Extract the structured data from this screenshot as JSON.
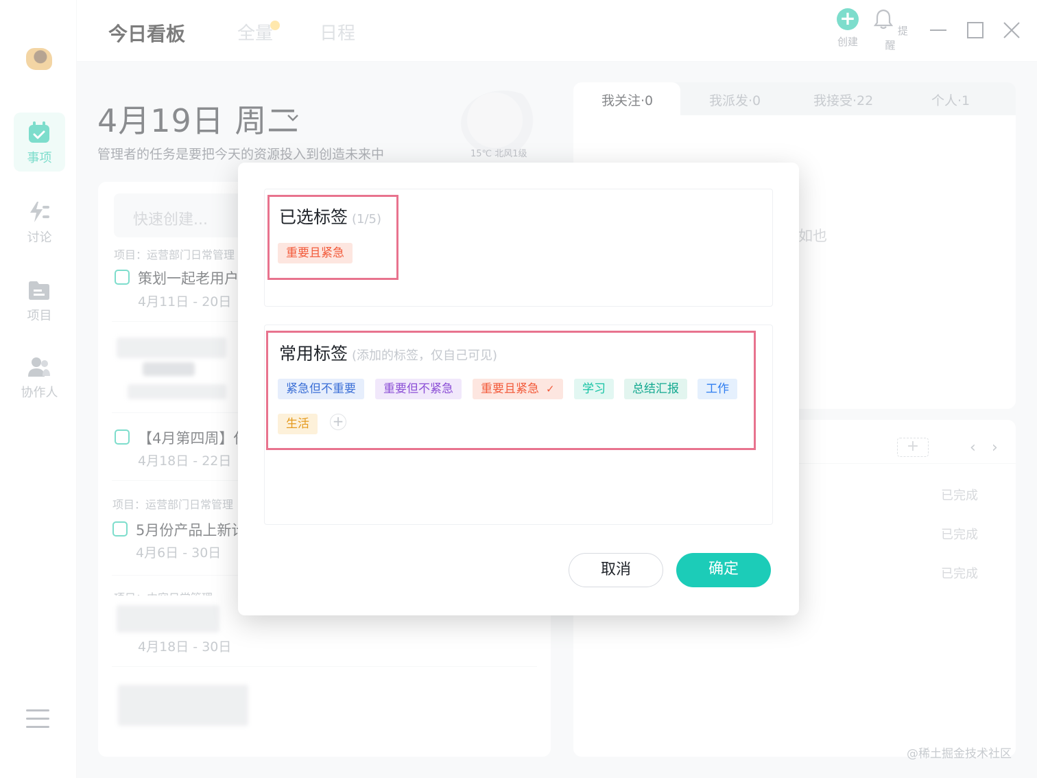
{
  "app": {
    "tabs": [
      {
        "label": "今日看板",
        "active": true
      },
      {
        "label": "全量",
        "active": false
      },
      {
        "label": "日程",
        "active": false
      }
    ],
    "actions": [
      {
        "label": "创建",
        "icon": "plus-circle-icon"
      },
      {
        "label": "提醒",
        "icon": "bell-icon"
      }
    ],
    "accent": "#13c2a3"
  },
  "sidebar": {
    "items": [
      {
        "label": "事项",
        "icon": "calendar-check-icon",
        "active": true
      },
      {
        "label": "讨论",
        "icon": "discussion-icon",
        "active": false
      },
      {
        "label": "项目",
        "icon": "folder-icon",
        "active": false
      },
      {
        "label": "协作人",
        "icon": "people-icon",
        "active": false
      }
    ]
  },
  "header": {
    "date": "4月19日 周二",
    "motto": "管理者的任务是要把今天的资源投入到创造未来中",
    "weather": "15℃ 北风1级"
  },
  "left_panel": {
    "quick_create": "快速创建...",
    "groups": [
      {
        "project": "项目：运营部门日常管理",
        "tasks": [
          {
            "title": "策划一起老用户",
            "date": "4月11日 - 20日"
          }
        ]
      },
      {
        "project": "",
        "tasks": [
          {
            "title": "【4月第四周】任",
            "date": "4月18日 - 22日"
          }
        ]
      },
      {
        "project": "项目：运营部门日常管理",
        "tasks": [
          {
            "title": "5月份产品上新计",
            "date": "4月6日 - 30日"
          }
        ]
      },
      {
        "project": "项目：内容日常管理",
        "tasks": [
          {
            "title": "",
            "date": "4月18日 - 30日"
          }
        ]
      }
    ]
  },
  "right_panel": {
    "tabs": [
      {
        "label": "我关注·0",
        "active": true
      },
      {
        "label": "我派发·0",
        "active": false
      },
      {
        "label": "我接受·22",
        "active": false
      },
      {
        "label": "个人·1",
        "active": false
      }
    ],
    "empty_text_fragment": "如也",
    "status_items": [
      "已完成",
      "已完成",
      "已完成"
    ]
  },
  "dialog": {
    "selected": {
      "title": "已选标签",
      "count": "(1/5)",
      "tags": [
        {
          "label": "重要且紧急",
          "color": "#f25a3a",
          "bg": "#fde6e0"
        }
      ]
    },
    "common": {
      "title": "常用标签",
      "subtitle": "(添加的标签，仅自己可见)",
      "tags": [
        {
          "label": "紧急但不重要",
          "color": "#3b6fd6",
          "bg": "#e6eefc",
          "checked": false
        },
        {
          "label": "重要但不紧急",
          "color": "#8c4fd6",
          "bg": "#f1e8fb",
          "checked": false
        },
        {
          "label": "重要且紧急",
          "color": "#f25a3a",
          "bg": "#fde6e0",
          "checked": true
        },
        {
          "label": "学习",
          "color": "#13c2a3",
          "bg": "#e2f7f2",
          "checked": false
        },
        {
          "label": "总结汇报",
          "color": "#11a88f",
          "bg": "#e2f5ef",
          "checked": false
        },
        {
          "label": "工作",
          "color": "#2f7df0",
          "bg": "#e5f0fd",
          "checked": false
        },
        {
          "label": "生活",
          "color": "#e59a1d",
          "bg": "#fdf1da",
          "checked": false
        }
      ],
      "check_mark": "✓",
      "add_label": "+"
    },
    "buttons": {
      "cancel": "取消",
      "ok": "确定"
    }
  },
  "watermark": "@稀土掘金技术社区"
}
